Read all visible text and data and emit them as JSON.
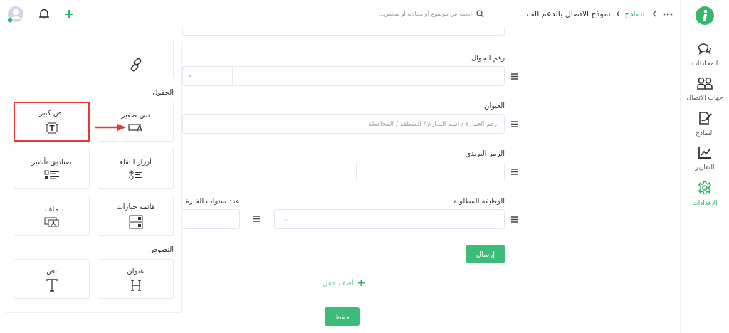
{
  "topbar": {
    "breadcrumb": [
      {
        "label": "النماذج",
        "kind": "link"
      },
      {
        "label": "نموذج الاتصال بالدعم الف...",
        "kind": "current"
      }
    ],
    "search": {
      "placeholder": "ابحث عن موضوع أو محادثة أو شخص..."
    },
    "avatar": {
      "online": true
    }
  },
  "sidebar": {
    "items": [
      {
        "label": "المحادثات",
        "kind": "chat",
        "selected": false
      },
      {
        "label": "جهات الاتصال",
        "kind": "people",
        "selected": false
      },
      {
        "label": "النماذج",
        "kind": "form",
        "selected": false
      },
      {
        "label": "التقارير",
        "kind": "chart",
        "selected": false
      },
      {
        "label": "الإعدادات",
        "kind": "gear",
        "selected": true
      }
    ]
  },
  "form": {
    "fields": [
      {
        "kind": "partial"
      },
      {
        "kind": "phone",
        "label": "رقم الجوال"
      },
      {
        "kind": "text",
        "label": "العنوان",
        "placeholder": "رقم العمارة / اسم الشارع / المنطقة / المحافظة"
      },
      {
        "kind": "short",
        "label": "الرمز البريدي"
      },
      {
        "kind": "pair",
        "label": "الوظيفة المطلوبة",
        "second_label": "عدد سنوات الخبرة"
      }
    ],
    "submit": "إرسال",
    "add_field": "أضف حقل"
  },
  "save": "حفظ",
  "palette": {
    "sections": [
      {
        "items": [
          {
            "kind": "link",
            "highlighted": false
          }
        ]
      },
      {
        "title": "الحقول",
        "items": [
          {
            "label": "نص صغير",
            "kind": "small-text",
            "highlighted": false
          },
          {
            "label": "نص كبير",
            "kind": "big-text",
            "highlighted": true
          },
          {
            "label": "أزرار انتقاء",
            "kind": "radio",
            "highlighted": false
          },
          {
            "label": "صناديق تأشير",
            "kind": "checkbox",
            "highlighted": false
          },
          {
            "label": "قائمة خيارات",
            "kind": "dropdown",
            "highlighted": false
          },
          {
            "label": "ملف",
            "kind": "file",
            "highlighted": false
          }
        ]
      },
      {
        "title": "النصوص",
        "items": [
          {
            "label": "عنوان",
            "kind": "heading",
            "highlighted": false
          },
          {
            "label": "نص",
            "kind": "text",
            "highlighted": false
          }
        ]
      }
    ],
    "arrow": true
  }
}
